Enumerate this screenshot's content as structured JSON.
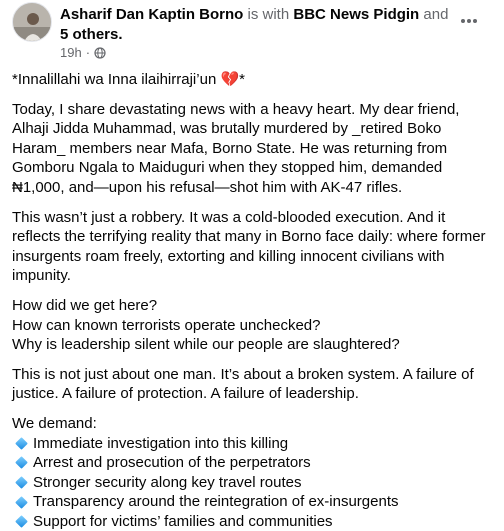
{
  "post": {
    "author": "Asharif Dan Kaptin Borno",
    "with_text": "is with",
    "tagged_page": "BBC News Pidgin",
    "and_text": "and",
    "others": "5 others.",
    "timestamp": "19h",
    "dot": "·",
    "more_icon": "more-options-icon",
    "privacy_icon": "globe-icon"
  },
  "content": {
    "opening_line": "*Innalillahi wa Inna ilaihirraji’un",
    "opening_emoji": "💔",
    "opening_end": "*",
    "p1": [
      "Today, I share devastating news with a heavy heart. My dear friend,",
      "Alhaji Jidda Muhammad, was brutally murdered by _retired Boko",
      "Haram_ members near Mafa, Borno State. He was returning from",
      "Gomboru Ngala to Maiduguri when they stopped him, demanded",
      "₦1,000, and—upon his refusal—shot him with AK-47 rifles."
    ],
    "p2": [
      "This wasn’t just a robbery. It was a cold-blooded execution. And it",
      "reflects the terrifying reality that many in Borno face daily: where former",
      "insurgents roam freely, extorting and killing innocent civilians with",
      "impunity."
    ],
    "p3": [
      "How did we get here?",
      "How can known terrorists operate unchecked?",
      "Why is leadership silent while our people are slaughtered?"
    ],
    "p4": [
      "This is not just about one man. It’s about a broken system. A failure of",
      "justice. A failure of protection. A failure of leadership."
    ],
    "demand_intro": "We demand:",
    "demands": [
      "Immediate investigation into this killing",
      "Arrest and prosecution of the perpetrators",
      "Stronger security along key travel routes",
      "Transparency around the reintegration of ex-insurgents",
      "Support for victims’ families and communities"
    ],
    "bullet_icon": "blue-diamond-icon"
  }
}
